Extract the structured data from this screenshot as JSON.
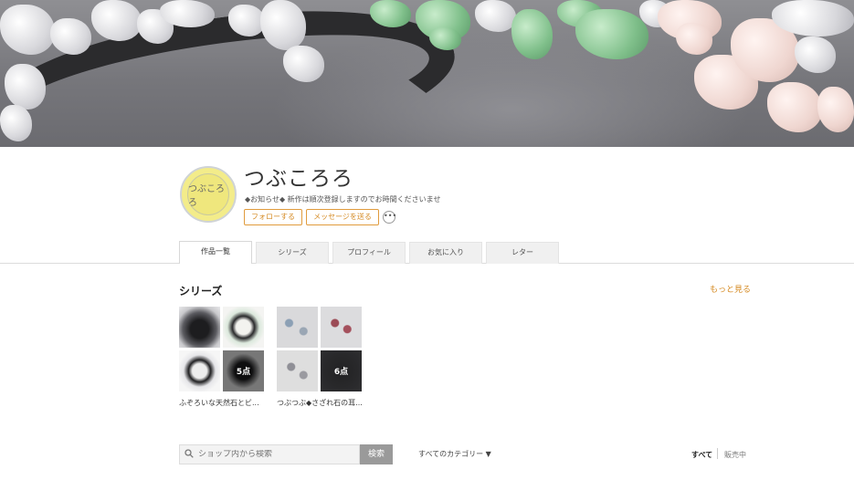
{
  "shop": {
    "name": "つぶころろ",
    "avatar_text": "つぶころろ",
    "notice": "◆お知らせ◆ 新作は順次登録しますのでお時間くださいませ"
  },
  "actions": {
    "follow": "フォローする",
    "message": "メッセージを送る",
    "more": "•••"
  },
  "tabs": [
    {
      "label": "作品一覧",
      "active": true
    },
    {
      "label": "シリーズ",
      "active": false
    },
    {
      "label": "プロフィール",
      "active": false
    },
    {
      "label": "お気に入り",
      "active": false
    },
    {
      "label": "レター",
      "active": false
    }
  ],
  "series_section": {
    "title": "シリーズ",
    "see_more": "もっと見る",
    "cards": [
      {
        "caption": "ふぞろいな天然石とビ...",
        "count": "5点"
      },
      {
        "caption": "つぶつぶ◆さざれ石の耳...",
        "count": "6点"
      }
    ]
  },
  "toolbar": {
    "search_placeholder": "ショップ内から検索",
    "search_button": "検索",
    "category": "すべてのカテゴリー ▼",
    "sort_all": "すべて",
    "sort_on_sale": "販売中"
  },
  "icons": {
    "search": "search-icon",
    "more": "more-dots-icon"
  },
  "colors": {
    "accent": "#d58a22",
    "avatar_bg": "#f3ec8a"
  }
}
